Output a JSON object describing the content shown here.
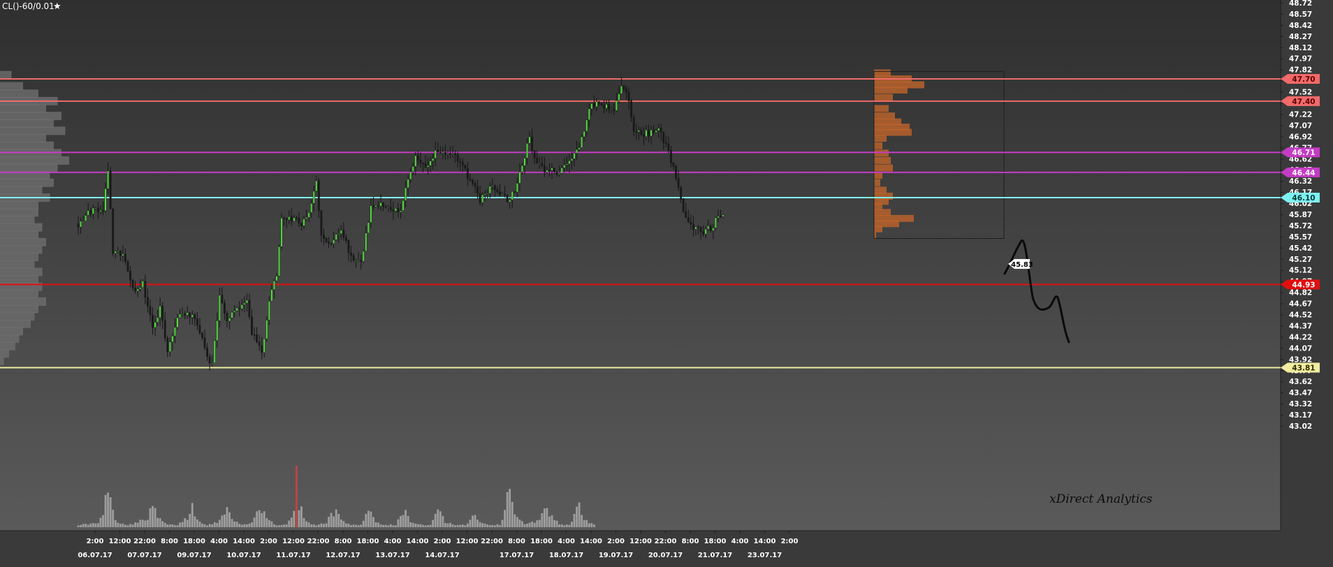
{
  "chart_data": {
    "type": "candlestick",
    "symbol_label": "CL()-60/0.01",
    "watermark": "xDirect Analytics",
    "colors": {
      "background_top": "#2f2f2f",
      "background_bottom": "#5a5a5a",
      "bar_up": "#55e040",
      "bar_down": "#1a1a1a",
      "volume": "#b5b5b5",
      "volume_highlight": "#d04040",
      "profile": "#b7622c",
      "left_profile": "#6e6e6e"
    },
    "ylim": [
      42.92,
      48.77
    ],
    "y_ticks": [
      "48.72",
      "48.57",
      "48.42",
      "48.27",
      "48.12",
      "47.97",
      "47.82",
      "47.67",
      "47.52",
      "47.37",
      "47.22",
      "47.07",
      "46.92",
      "46.77",
      "46.62",
      "46.47",
      "46.32",
      "46.17",
      "46.02",
      "45.87",
      "45.72",
      "45.57",
      "45.42",
      "45.27",
      "45.12",
      "44.97",
      "44.82",
      "44.67",
      "44.52",
      "44.37",
      "44.22",
      "44.07",
      "43.92",
      "43.77",
      "43.62",
      "43.47",
      "43.32",
      "43.17",
      "43.02"
    ],
    "x_ticks": [
      {
        "time": "2:00",
        "date": "06.07.17",
        "bar": 0
      },
      {
        "time": "12:00",
        "bar": 10
      },
      {
        "time": "22:00",
        "date": "07.07.17",
        "bar": 20
      },
      {
        "time": "8:00",
        "bar": 30
      },
      {
        "time": "18:00",
        "date": "09.07.17",
        "bar": 40
      },
      {
        "time": "4:00",
        "bar": 50
      },
      {
        "time": "14:00",
        "date": "10.07.17",
        "bar": 60
      },
      {
        "time": "2:00",
        "bar": 70
      },
      {
        "time": "12:00",
        "date": "11.07.17",
        "bar": 80
      },
      {
        "time": "22:00",
        "bar": 90
      },
      {
        "time": "8:00",
        "date": "12.07.17",
        "bar": 100
      },
      {
        "time": "18:00",
        "bar": 110
      },
      {
        "time": "4:00",
        "date": "13.07.17",
        "bar": 120
      },
      {
        "time": "14:00",
        "bar": 130
      },
      {
        "time": "2:00",
        "date": "14.07.17",
        "bar": 140
      },
      {
        "time": "12:00",
        "bar": 150
      },
      {
        "time": "22:00",
        "bar": 160
      },
      {
        "time": "8:00",
        "date": "17.07.17",
        "bar": 170
      },
      {
        "time": "18:00",
        "bar": 180
      },
      {
        "time": "4:00",
        "date": "18.07.17",
        "bar": 190
      },
      {
        "time": "14:00",
        "bar": 200
      },
      {
        "time": "2:00",
        "date": "19.07.17",
        "bar": 210
      },
      {
        "time": "12:00",
        "bar": 220
      },
      {
        "time": "22:00",
        "date": "20.07.17",
        "bar": 230
      },
      {
        "time": "8:00",
        "bar": 240
      },
      {
        "time": "18:00",
        "date": "21.07.17",
        "bar": 250
      },
      {
        "time": "4:00",
        "bar": 260
      },
      {
        "time": "14:00",
        "date": "23.07.17",
        "bar": 270
      },
      {
        "time": "2:00",
        "bar": 280
      }
    ],
    "price_anchors": [
      [
        0,
        45.75
      ],
      [
        6,
        45.95
      ],
      [
        10,
        45.9
      ],
      [
        12,
        46.45
      ],
      [
        14,
        45.4
      ],
      [
        18,
        45.35
      ],
      [
        22,
        44.85
      ],
      [
        26,
        44.95
      ],
      [
        30,
        44.35
      ],
      [
        33,
        44.6
      ],
      [
        36,
        44.0
      ],
      [
        40,
        44.5
      ],
      [
        44,
        44.55
      ],
      [
        48,
        44.4
      ],
      [
        52,
        43.95
      ],
      [
        54,
        43.85
      ],
      [
        57,
        44.75
      ],
      [
        60,
        44.45
      ],
      [
        64,
        44.6
      ],
      [
        68,
        44.75
      ],
      [
        70,
        44.3
      ],
      [
        74,
        44.0
      ],
      [
        78,
        44.9
      ],
      [
        80,
        45.05
      ],
      [
        82,
        45.85
      ],
      [
        86,
        45.8
      ],
      [
        90,
        45.75
      ],
      [
        94,
        46.0
      ],
      [
        96,
        46.3
      ],
      [
        98,
        45.55
      ],
      [
        102,
        45.5
      ],
      [
        106,
        45.65
      ],
      [
        110,
        45.3
      ],
      [
        114,
        45.2
      ],
      [
        116,
        45.6
      ],
      [
        118,
        45.95
      ],
      [
        122,
        46.0
      ],
      [
        126,
        45.98
      ],
      [
        130,
        45.9
      ],
      [
        134,
        46.5
      ],
      [
        136,
        46.62
      ],
      [
        140,
        46.5
      ],
      [
        144,
        46.7
      ],
      [
        148,
        46.65
      ],
      [
        152,
        46.7
      ],
      [
        154,
        46.55
      ],
      [
        158,
        46.35
      ],
      [
        162,
        46.08
      ],
      [
        166,
        46.25
      ],
      [
        170,
        46.15
      ],
      [
        174,
        46.05
      ],
      [
        178,
        46.4
      ],
      [
        182,
        46.95
      ],
      [
        184,
        46.6
      ],
      [
        188,
        46.45
      ],
      [
        192,
        46.45
      ],
      [
        196,
        46.5
      ],
      [
        200,
        46.65
      ],
      [
        204,
        46.95
      ],
      [
        206,
        47.3
      ],
      [
        208,
        47.35
      ],
      [
        212,
        47.35
      ],
      [
        216,
        47.3
      ],
      [
        219,
        47.6
      ],
      [
        221,
        47.55
      ],
      [
        224,
        47.02
      ],
      [
        227,
        46.95
      ],
      [
        230,
        46.97
      ],
      [
        234,
        47.02
      ],
      [
        238,
        46.72
      ],
      [
        240,
        46.48
      ],
      [
        244,
        45.9
      ],
      [
        248,
        45.72
      ],
      [
        252,
        45.64
      ],
      [
        256,
        45.72
      ],
      [
        258,
        45.85
      ],
      [
        260,
        45.82
      ]
    ],
    "volume_anchors": [
      [
        0,
        0.05
      ],
      [
        8,
        0.08
      ],
      [
        10,
        0.25
      ],
      [
        12,
        0.9
      ],
      [
        14,
        0.3
      ],
      [
        16,
        0.1
      ],
      [
        20,
        0.05
      ],
      [
        24,
        0.1
      ],
      [
        28,
        0.2
      ],
      [
        30,
        0.45
      ],
      [
        32,
        0.2
      ],
      [
        36,
        0.05
      ],
      [
        40,
        0.05
      ],
      [
        44,
        0.2
      ],
      [
        46,
        0.45
      ],
      [
        48,
        0.15
      ],
      [
        52,
        0.05
      ],
      [
        56,
        0.1
      ],
      [
        58,
        0.25
      ],
      [
        60,
        0.45
      ],
      [
        62,
        0.15
      ],
      [
        66,
        0.05
      ],
      [
        70,
        0.1
      ],
      [
        72,
        0.3
      ],
      [
        74,
        0.4
      ],
      [
        76,
        0.15
      ],
      [
        80,
        0.05
      ],
      [
        84,
        0.05
      ],
      [
        86,
        0.2
      ],
      [
        88,
        0.55
      ],
      [
        90,
        0.35
      ],
      [
        92,
        0.1
      ],
      [
        96,
        0.05
      ],
      [
        100,
        0.1
      ],
      [
        102,
        0.25
      ],
      [
        104,
        0.35
      ],
      [
        106,
        0.15
      ],
      [
        110,
        0.05
      ],
      [
        114,
        0.05
      ],
      [
        116,
        0.25
      ],
      [
        118,
        0.4
      ],
      [
        120,
        0.1
      ],
      [
        124,
        0.05
      ],
      [
        128,
        0.05
      ],
      [
        130,
        0.3
      ],
      [
        132,
        0.35
      ],
      [
        134,
        0.1
      ],
      [
        138,
        0.05
      ],
      [
        142,
        0.05
      ],
      [
        144,
        0.25
      ],
      [
        146,
        0.35
      ],
      [
        148,
        0.1
      ],
      [
        152,
        0.05
      ],
      [
        156,
        0.05
      ],
      [
        158,
        0.15
      ],
      [
        160,
        0.3
      ],
      [
        162,
        0.1
      ],
      [
        166,
        0.05
      ],
      [
        170,
        0.05
      ],
      [
        172,
        0.35
      ],
      [
        174,
        0.95
      ],
      [
        176,
        0.3
      ],
      [
        180,
        0.05
      ],
      [
        186,
        0.15
      ],
      [
        188,
        0.45
      ],
      [
        190,
        0.3
      ],
      [
        194,
        0.05
      ],
      [
        198,
        0.05
      ],
      [
        200,
        0.25
      ],
      [
        202,
        0.45
      ],
      [
        204,
        0.15
      ],
      [
        208,
        0.05
      ]
    ],
    "volume_highlight_bar": 88,
    "profile_right": [
      [
        47.78,
        0.4
      ],
      [
        47.7,
        0.9
      ],
      [
        47.62,
        1.2
      ],
      [
        47.55,
        0.8
      ],
      [
        47.45,
        0.45
      ],
      [
        47.3,
        0.35
      ],
      [
        47.2,
        0.5
      ],
      [
        47.12,
        0.65
      ],
      [
        47.05,
        0.85
      ],
      [
        46.98,
        0.9
      ],
      [
        46.9,
        0.3
      ],
      [
        46.8,
        0.2
      ],
      [
        46.7,
        0.35
      ],
      [
        46.6,
        0.4
      ],
      [
        46.5,
        0.45
      ],
      [
        46.4,
        0.2
      ],
      [
        46.3,
        0.15
      ],
      [
        46.2,
        0.3
      ],
      [
        46.12,
        0.45
      ],
      [
        46.05,
        0.35
      ],
      [
        45.98,
        0.2
      ],
      [
        45.9,
        0.4
      ],
      [
        45.82,
        0.95
      ],
      [
        45.75,
        0.6
      ],
      [
        45.68,
        0.2
      ],
      [
        45.6,
        0.05
      ]
    ],
    "profile_left": [
      [
        47.75,
        0.15
      ],
      [
        47.6,
        0.3
      ],
      [
        47.5,
        0.5
      ],
      [
        47.4,
        0.75
      ],
      [
        47.3,
        0.6
      ],
      [
        47.2,
        0.8
      ],
      [
        47.1,
        0.7
      ],
      [
        47.0,
        0.85
      ],
      [
        46.9,
        0.6
      ],
      [
        46.8,
        0.7
      ],
      [
        46.7,
        0.8
      ],
      [
        46.6,
        0.9
      ],
      [
        46.5,
        0.75
      ],
      [
        46.4,
        0.65
      ],
      [
        46.3,
        0.7
      ],
      [
        46.2,
        0.55
      ],
      [
        46.1,
        0.65
      ],
      [
        46.0,
        0.5
      ],
      [
        45.9,
        0.5
      ],
      [
        45.8,
        0.45
      ],
      [
        45.7,
        0.55
      ],
      [
        45.6,
        0.5
      ],
      [
        45.5,
        0.6
      ],
      [
        45.4,
        0.55
      ],
      [
        45.3,
        0.5
      ],
      [
        45.2,
        0.45
      ],
      [
        45.1,
        0.55
      ],
      [
        45.0,
        0.5
      ],
      [
        44.9,
        0.55
      ],
      [
        44.8,
        0.5
      ],
      [
        44.7,
        0.6
      ],
      [
        44.6,
        0.5
      ],
      [
        44.5,
        0.45
      ],
      [
        44.4,
        0.4
      ],
      [
        44.3,
        0.3
      ],
      [
        44.2,
        0.25
      ],
      [
        44.1,
        0.2
      ],
      [
        44.0,
        0.12
      ],
      [
        43.9,
        0.05
      ]
    ],
    "levels": [
      {
        "label": "47.70",
        "price": 47.7,
        "color": "#f26a6a",
        "label_text": "#5a0000"
      },
      {
        "label": "47.40",
        "price": 47.4,
        "color": "#f26a6a",
        "label_text": "#5a0000"
      },
      {
        "label": "46.71",
        "price": 46.71,
        "color": "#c43cc4",
        "label_text": "#ffffff"
      },
      {
        "label": "46.44",
        "price": 46.44,
        "color": "#c43cc4",
        "label_text": "#ffffff"
      },
      {
        "label": "46.10",
        "price": 46.1,
        "color": "#7ff0f0",
        "label_text": "#003a3a"
      },
      {
        "label": "44.93",
        "price": 44.93,
        "color": "#e01010",
        "label_text": "#ffffff"
      },
      {
        "label": "43.81",
        "price": 43.81,
        "color": "#f0eca0",
        "label_text": "#2a2a00"
      }
    ],
    "last_price": {
      "label": "45.83",
      "price": 45.83
    }
  }
}
